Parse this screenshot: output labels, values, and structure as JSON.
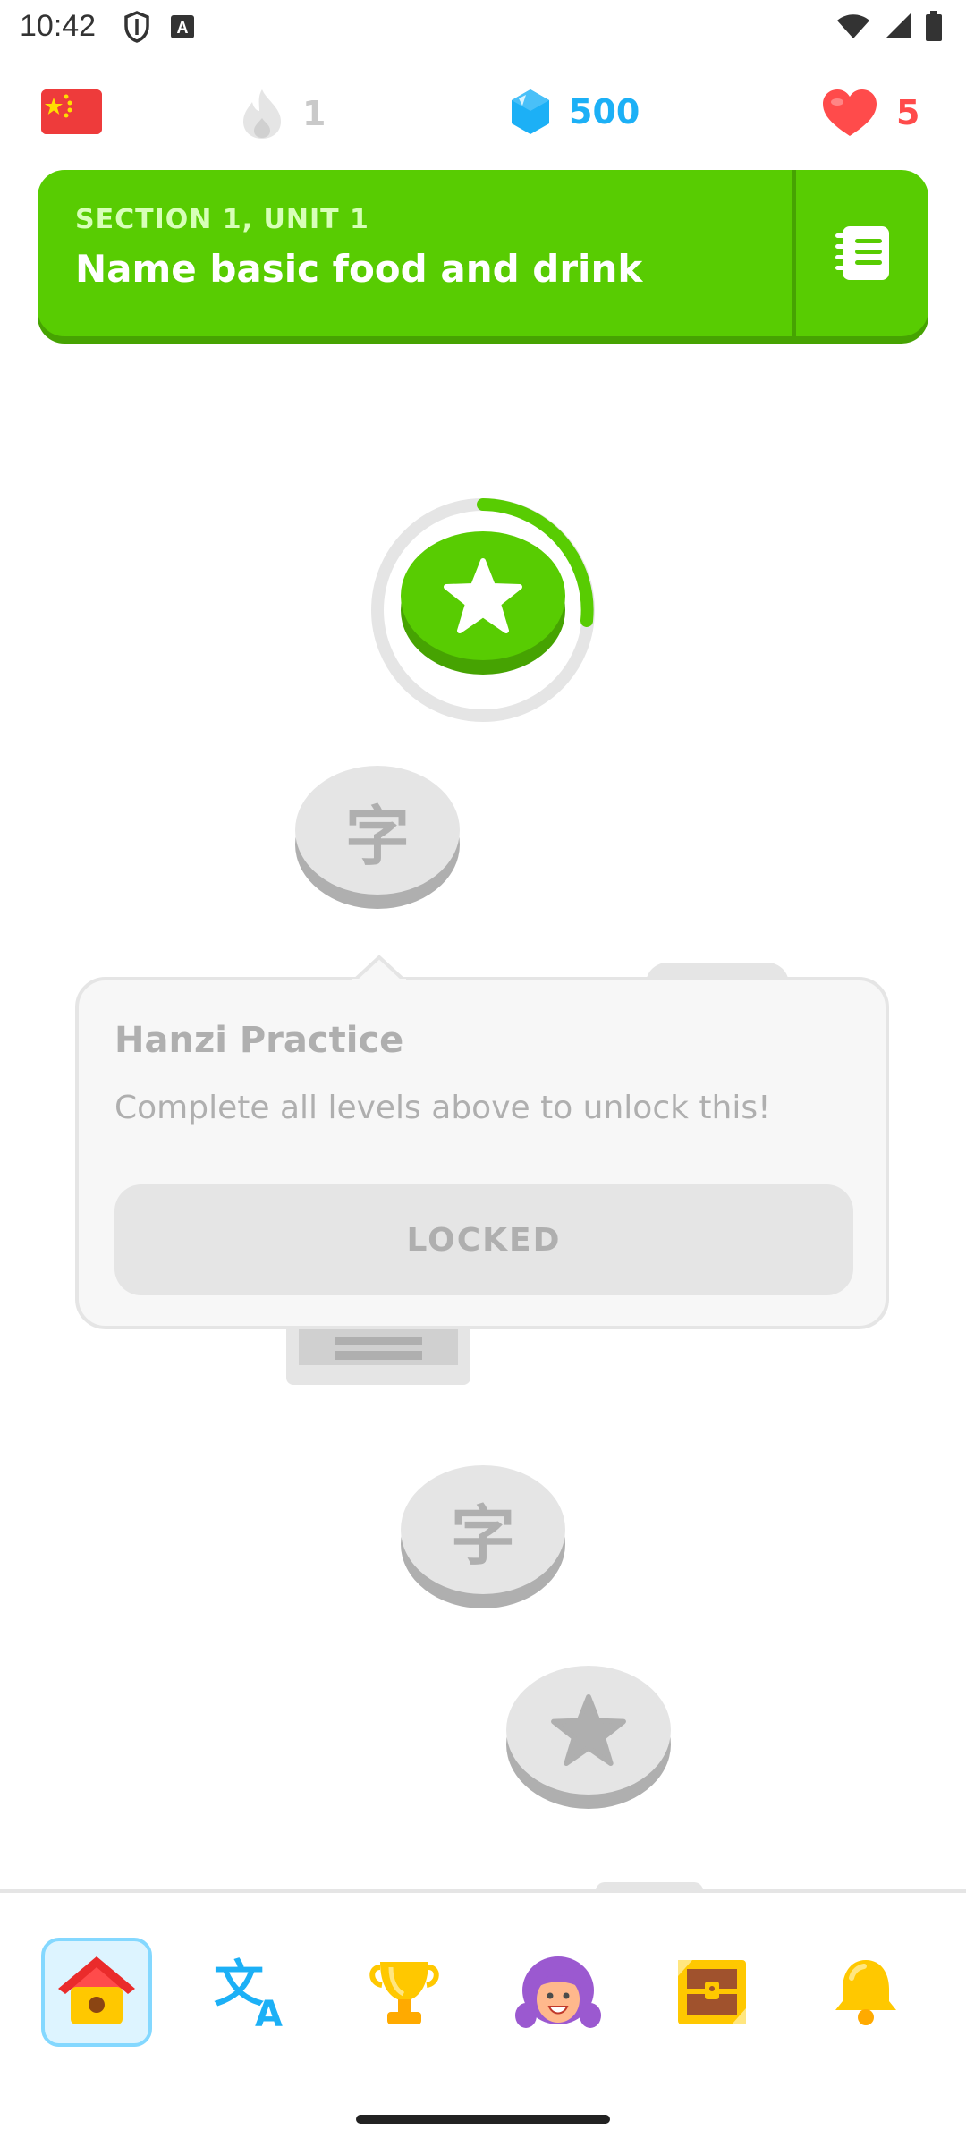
{
  "status": {
    "time": "10:42"
  },
  "stats": {
    "streak": "1",
    "gems": "500",
    "hearts": "5"
  },
  "unit": {
    "section_label": "SECTION 1, UNIT 1",
    "title": "Name basic food and drink"
  },
  "path": {
    "nodes": [
      {
        "type": "lesson",
        "state": "current",
        "icon": "star-icon",
        "progress": 0.25
      },
      {
        "type": "hanzi",
        "state": "locked",
        "glyph": "字"
      },
      {
        "type": "chest",
        "state": "locked"
      },
      {
        "type": "hanzi",
        "state": "locked",
        "glyph": "字"
      },
      {
        "type": "lesson",
        "state": "locked",
        "icon": "star-icon"
      }
    ]
  },
  "popover": {
    "title": "Hanzi Practice",
    "description": "Complete all levels above to unlock this!",
    "button_label": "LOCKED"
  },
  "nav": {
    "items": [
      "home-icon",
      "characters-icon",
      "leaderboard-icon",
      "profile-icon",
      "quests-icon",
      "notifications-icon"
    ],
    "active": "home-icon"
  },
  "colors": {
    "primary_green": "#58cc02",
    "gem_blue": "#1cb0f6",
    "heart_red": "#ff4b4b",
    "locked_gray": "#afafaf"
  }
}
